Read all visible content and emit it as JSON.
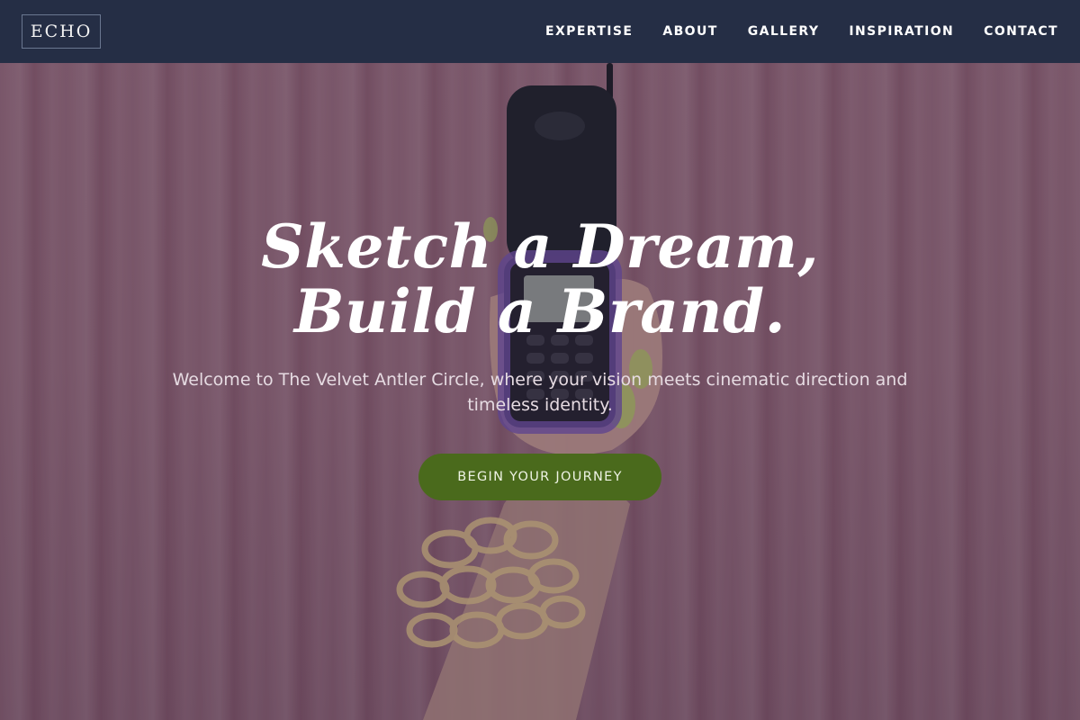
{
  "header": {
    "logo_text": "ECHO",
    "nav": [
      {
        "label": "EXPERTISE"
      },
      {
        "label": "ABOUT"
      },
      {
        "label": "GALLERY"
      },
      {
        "label": "INSPIRATION"
      },
      {
        "label": "CONTACT"
      }
    ]
  },
  "hero": {
    "title": "Sketch a Dream, Build a Brand.",
    "subtitle": "Welcome to The Velvet Antler Circle, where your vision meets cinematic direction and timeless identity.",
    "cta_label": "BEGIN YOUR JOURNEY",
    "background_description_icon": "hand-holding-flip-phone-image"
  },
  "colors": {
    "header_bg": "#252e45",
    "cta_bg": "#4a6a1c",
    "hero_tint": "#7a5466",
    "text_light": "#ffffff"
  }
}
